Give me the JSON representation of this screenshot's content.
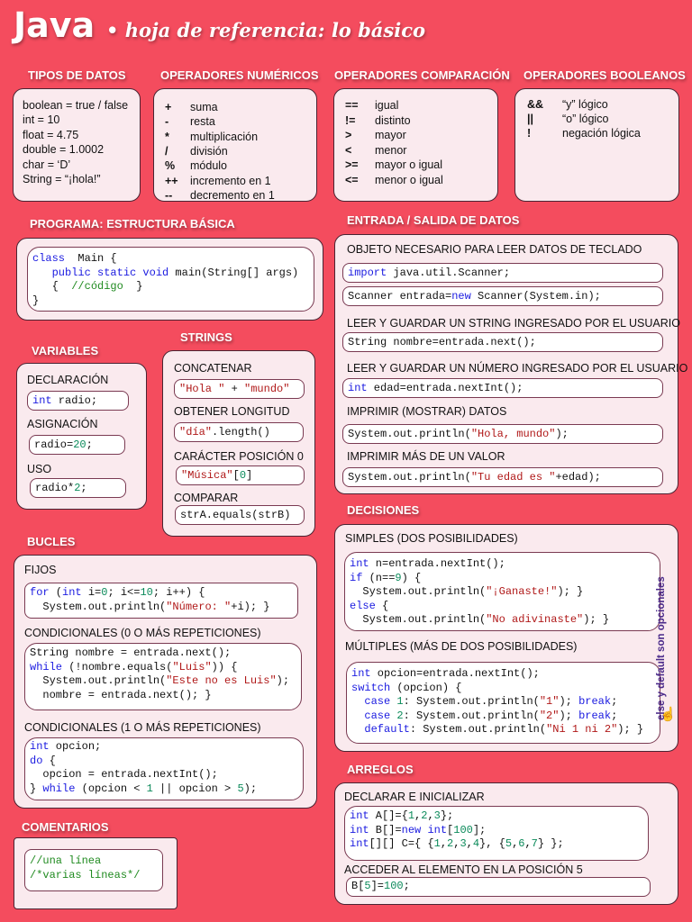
{
  "header": {
    "title": "Java",
    "subtitle": "• hoja de referencia: lo básico"
  },
  "tipos": {
    "heading": "TIPOS DE DATOS",
    "lines": [
      "boolean = true / false",
      "int = 10",
      "float = 4.75",
      "double = 1.0002",
      "char = ‘D’",
      "String = “¡hola!”"
    ]
  },
  "numericos": {
    "heading": "OPERADORES NUMÉRICOS",
    "rows": [
      [
        "+",
        "suma"
      ],
      [
        "-",
        "resta"
      ],
      [
        "*",
        "multiplicación"
      ],
      [
        "/",
        "división"
      ],
      [
        "%",
        "módulo"
      ],
      [
        "++",
        "incremento en 1"
      ],
      [
        "--",
        "decremento en 1"
      ]
    ]
  },
  "comparacion": {
    "heading": "OPERADORES COMPARACIÓN",
    "rows": [
      [
        "==",
        "igual"
      ],
      [
        "!=",
        "distinto"
      ],
      [
        ">",
        "mayor"
      ],
      [
        "<",
        "menor"
      ],
      [
        ">=",
        "mayor o igual"
      ],
      [
        "<=",
        "menor o igual"
      ]
    ]
  },
  "booleanos": {
    "heading": "OPERADORES BOOLEANOS",
    "rows": [
      [
        "&&",
        "“y” lógico"
      ],
      [
        "||",
        "“o” lógico"
      ],
      [
        "!",
        "negación lógica"
      ]
    ]
  },
  "programa": {
    "heading": "PROGRAMA: ESTRUCTURA BÁSICA",
    "code": [
      [
        [
          "k",
          "class"
        ],
        [
          "",
          "  Main {"
        ]
      ],
      [
        [
          "",
          "   "
        ],
        [
          "k",
          "public static void"
        ],
        [
          "",
          " main(String[] args)"
        ]
      ],
      [
        [
          "",
          "   {  "
        ],
        [
          "c",
          "//código"
        ],
        [
          "",
          "  }"
        ]
      ],
      [
        [
          "",
          "}"
        ]
      ]
    ]
  },
  "entrada": {
    "heading": "ENTRADA / SALIDA DE DATOS",
    "items": [
      {
        "label": "OBJETO NECESARIO PARA LEER DATOS DE TECLADO",
        "code": [
          [
            [
              "k",
              "import"
            ],
            [
              "",
              " java.util.Scanner;"
            ]
          ]
        ],
        "code2": [
          [
            [
              "",
              "Scanner entrada="
            ],
            [
              "k",
              "new"
            ],
            [
              "",
              " Scanner(System.in);"
            ]
          ]
        ]
      },
      {
        "label": "LEER Y GUARDAR UN STRING INGRESADO POR EL USUARIO",
        "code": [
          [
            [
              "",
              "String nombre=entrada.next();"
            ]
          ]
        ]
      },
      {
        "label": "LEER Y GUARDAR UN NÚMERO INGRESADO POR EL USUARIO",
        "code": [
          [
            [
              "k",
              "int"
            ],
            [
              "",
              " edad=entrada.nextInt();"
            ]
          ]
        ]
      },
      {
        "label": "IMPRIMIR (MOSTRAR) DATOS",
        "code": [
          [
            [
              "",
              "System.out.println("
            ],
            [
              "s",
              "\"Hola, mundo\""
            ],
            [
              "",
              ");"
            ]
          ]
        ]
      },
      {
        "label": "IMPRIMIR MÁS DE UN VALOR",
        "code": [
          [
            [
              "",
              "System.out.println("
            ],
            [
              "s",
              "\"Tu edad es \""
            ],
            [
              "",
              "+edad);"
            ]
          ]
        ]
      }
    ]
  },
  "variables": {
    "heading": "VARIABLES",
    "items": [
      {
        "label": "DECLARACIÓN",
        "code": [
          [
            [
              "k",
              "int"
            ],
            [
              "",
              " radio;"
            ]
          ]
        ]
      },
      {
        "label": "ASIGNACIÓN",
        "code": [
          [
            [
              "",
              "radio="
            ],
            [
              "n",
              "20"
            ],
            [
              "",
              ";"
            ]
          ]
        ]
      },
      {
        "label": "USO",
        "code": [
          [
            [
              "",
              "radio*"
            ],
            [
              "n",
              "2"
            ],
            [
              "",
              ";"
            ]
          ]
        ]
      }
    ]
  },
  "strings": {
    "heading": "STRINGS",
    "items": [
      {
        "label": "CONCATENAR",
        "code": [
          [
            [
              "s",
              "\"Hola \""
            ],
            [
              "",
              " + "
            ],
            [
              "s",
              "\"mundo\""
            ]
          ]
        ]
      },
      {
        "label": "OBTENER LONGITUD",
        "code": [
          [
            [
              "s",
              "\"día\""
            ],
            [
              "",
              ".length()"
            ]
          ]
        ]
      },
      {
        "label": "CARÁCTER POSICIÓN 0",
        "code": [
          [
            [
              "s",
              "\"Música\""
            ],
            [
              "",
              "["
            ],
            [
              "n",
              "0"
            ],
            [
              "",
              "]"
            ]
          ]
        ]
      },
      {
        "label": "COMPARAR",
        "code": [
          [
            [
              "",
              "strA.equals(strB)"
            ]
          ]
        ]
      }
    ]
  },
  "decisiones": {
    "heading": "DECISIONES",
    "side_note": "else y default son opcionales",
    "items": [
      {
        "label": "SIMPLES (DOS POSIBILIDADES)",
        "code": [
          [
            [
              "k",
              "int"
            ],
            [
              "",
              " n=entrada.nextInt();"
            ]
          ],
          [
            [
              "k",
              "if"
            ],
            [
              "",
              " (n=="
            ],
            [
              "n",
              "9"
            ],
            [
              "",
              ") {"
            ]
          ],
          [
            [
              "",
              "  System.out.println("
            ],
            [
              "s",
              "\"¡Ganaste!\""
            ],
            [
              "",
              "); }"
            ]
          ],
          [
            [
              "k",
              "else"
            ],
            [
              "",
              " {"
            ]
          ],
          [
            [
              "",
              "  System.out.println("
            ],
            [
              "s",
              "\"No adivinaste\""
            ],
            [
              "",
              "); }"
            ]
          ]
        ]
      },
      {
        "label": "MÚLTIPLES (MÁS DE DOS POSIBILIDADES)",
        "code": [
          [
            [
              "k",
              "int"
            ],
            [
              "",
              " opcion=entrada.nextInt();"
            ]
          ],
          [
            [
              "k",
              "switch"
            ],
            [
              "",
              " (opcion) {"
            ]
          ],
          [
            [
              "",
              "  "
            ],
            [
              "k",
              "case"
            ],
            [
              "",
              " "
            ],
            [
              "n",
              "1"
            ],
            [
              "",
              ": System.out.println("
            ],
            [
              "s",
              "\"1\""
            ],
            [
              "",
              "); "
            ],
            [
              "k",
              "break"
            ],
            [
              "",
              ";"
            ]
          ],
          [
            [
              "",
              "  "
            ],
            [
              "k",
              "case"
            ],
            [
              "",
              " "
            ],
            [
              "n",
              "2"
            ],
            [
              "",
              ": System.out.println("
            ],
            [
              "s",
              "\"2\""
            ],
            [
              "",
              "); "
            ],
            [
              "k",
              "break"
            ],
            [
              "",
              ";"
            ]
          ],
          [
            [
              "",
              "  "
            ],
            [
              "k",
              "default"
            ],
            [
              "",
              ": System.out.println("
            ],
            [
              "s",
              "\"Ni 1 ni 2\""
            ],
            [
              "",
              "); }"
            ]
          ]
        ]
      }
    ]
  },
  "bucles": {
    "heading": "BUCLES",
    "items": [
      {
        "label": "FIJOS",
        "code": [
          [
            [
              "k",
              "for"
            ],
            [
              "",
              " ("
            ],
            [
              "k",
              "int"
            ],
            [
              "",
              " i="
            ],
            [
              "n",
              "0"
            ],
            [
              "",
              "; i<="
            ],
            [
              "n",
              "10"
            ],
            [
              "",
              "; i++) {"
            ]
          ],
          [
            [
              "",
              "  System.out.println("
            ],
            [
              "s",
              "\"Número: \""
            ],
            [
              "",
              "+i); }"
            ]
          ]
        ]
      },
      {
        "label": "CONDICIONALES (0 O MÁS REPETICIONES)",
        "code": [
          [
            [
              "",
              "String nombre = entrada.next();"
            ]
          ],
          [
            [
              "k",
              "while"
            ],
            [
              "",
              " (!nombre.equals("
            ],
            [
              "s",
              "\"Luis\""
            ],
            [
              "",
              ")) {"
            ]
          ],
          [
            [
              "",
              "  System.out.println("
            ],
            [
              "s",
              "\"Este no es Luis\""
            ],
            [
              "",
              ");"
            ]
          ],
          [
            [
              "",
              "  nombre = entrada.next(); }"
            ]
          ]
        ]
      },
      {
        "label": "CONDICIONALES (1 O MÁS REPETICIONES)",
        "code": [
          [
            [
              "k",
              "int"
            ],
            [
              "",
              " opcion;"
            ]
          ],
          [
            [
              "k",
              "do"
            ],
            [
              "",
              " {"
            ]
          ],
          [
            [
              "",
              "  opcion = entrada.nextInt();"
            ]
          ],
          [
            [
              "",
              "} "
            ],
            [
              "k",
              "while"
            ],
            [
              "",
              " (opcion < "
            ],
            [
              "n",
              "1"
            ],
            [
              "",
              " || opcion > "
            ],
            [
              "n",
              "5"
            ],
            [
              "",
              ");"
            ]
          ]
        ]
      }
    ]
  },
  "comentarios": {
    "heading": "COMENTARIOS",
    "code": [
      [
        [
          "c",
          "//una línea"
        ]
      ],
      [
        [
          "c",
          "/*varias líneas*/"
        ]
      ]
    ]
  },
  "arreglos": {
    "heading": "ARREGLOS",
    "items": [
      {
        "label": "DECLARAR E INICIALIZAR",
        "code": [
          [
            [
              "k",
              "int"
            ],
            [
              "",
              " A[]={"
            ],
            [
              "n",
              "1"
            ],
            [
              "",
              ","
            ],
            [
              "n",
              "2"
            ],
            [
              "",
              ","
            ],
            [
              "n",
              "3"
            ],
            [
              "",
              "};"
            ]
          ],
          [
            [
              "k",
              "int"
            ],
            [
              "",
              " B[]="
            ],
            [
              "k",
              "new"
            ],
            [
              "",
              " "
            ],
            [
              "k",
              "int"
            ],
            [
              "",
              "["
            ],
            [
              "n",
              "100"
            ],
            [
              "",
              "];"
            ]
          ],
          [
            [
              "k",
              "int"
            ],
            [
              "",
              "[][] C={ {"
            ],
            [
              "n",
              "1"
            ],
            [
              "",
              ","
            ],
            [
              "n",
              "2"
            ],
            [
              "",
              ","
            ],
            [
              "n",
              "3"
            ],
            [
              "",
              ","
            ],
            [
              "n",
              "4"
            ],
            [
              "",
              "}, {"
            ],
            [
              "n",
              "5"
            ],
            [
              "",
              ","
            ],
            [
              "n",
              "6"
            ],
            [
              "",
              ","
            ],
            [
              "n",
              "7"
            ],
            [
              "",
              "} };"
            ]
          ]
        ]
      },
      {
        "label": "ACCEDER AL ELEMENTO EN LA POSICIÓN 5",
        "code": [
          [
            [
              "",
              "B["
            ],
            [
              "n",
              "5"
            ],
            [
              "",
              "]="
            ],
            [
              "n",
              "100"
            ],
            [
              "",
              ";"
            ]
          ]
        ]
      }
    ]
  }
}
